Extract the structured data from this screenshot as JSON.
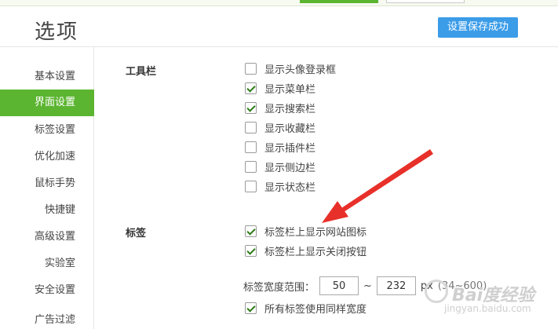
{
  "header": {
    "title": "选项",
    "toast": "设置保存成功"
  },
  "sidebar": {
    "items": [
      {
        "label": "基本设置",
        "active": false
      },
      {
        "label": "界面设置",
        "active": true
      },
      {
        "label": "标签设置",
        "active": false
      },
      {
        "label": "优化加速",
        "active": false
      },
      {
        "label": "鼠标手势",
        "active": false
      },
      {
        "label": "快捷键",
        "active": false
      },
      {
        "label": "高级设置",
        "active": false
      },
      {
        "label": "实验室",
        "active": false
      },
      {
        "label": "安全设置",
        "active": false
      },
      {
        "label": "广告过滤",
        "active": false
      }
    ]
  },
  "toolbar_section": {
    "title": "工具栏",
    "options": [
      {
        "label": "显示头像登录框",
        "checked": false
      },
      {
        "label": "显示菜单栏",
        "checked": true
      },
      {
        "label": "显示搜索栏",
        "checked": true
      },
      {
        "label": "显示收藏栏",
        "checked": false
      },
      {
        "label": "显示插件栏",
        "checked": false
      },
      {
        "label": "显示侧边栏",
        "checked": false
      },
      {
        "label": "显示状态栏",
        "checked": false
      }
    ]
  },
  "tabs_section": {
    "title": "标签",
    "options": [
      {
        "label": "标签栏上显示网站图标",
        "checked": true
      },
      {
        "label": "标签栏上显示关闭按钮",
        "checked": true
      }
    ],
    "width_range": {
      "label": "标签宽度范围：",
      "min_value": "50",
      "separator": "~",
      "max_value": "232",
      "unit": "px",
      "hint": "(34~600)"
    },
    "same_width": {
      "label": "所有标签使用同样宽度",
      "checked": true
    }
  },
  "watermark": {
    "text": "Bai度经验",
    "url": "jingyan.baidu.com"
  }
}
